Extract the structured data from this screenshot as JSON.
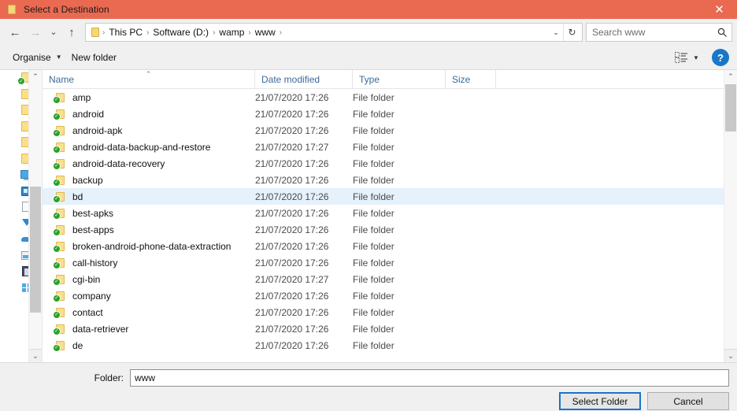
{
  "window": {
    "title": "Select a Destination",
    "icon": "folder-icon",
    "close_label": "✕",
    "titlebar_color": "#e96a51"
  },
  "nav": {
    "back": "←",
    "forward": "→",
    "recent": "⌄",
    "up": "↑",
    "dropdown": "⌄",
    "refresh": "↻"
  },
  "address": {
    "separator": "›",
    "crumbs": [
      "This PC",
      "Software (D:)",
      "wamp",
      "www"
    ]
  },
  "search": {
    "placeholder": "Search www",
    "value": "",
    "icon": "search-icon"
  },
  "commandbar": {
    "organise_label": "Organise",
    "organise_caret": "▼",
    "new_folder_label": "New folder",
    "view_caret": "▼",
    "help_label": "?"
  },
  "columns": {
    "name": "Name",
    "date_modified": "Date modified",
    "type": "Type",
    "size": "Size",
    "sort_caret": "⌃"
  },
  "files": [
    {
      "name": "amp",
      "date": "21/07/2020 17:26",
      "type": "File folder",
      "size": "",
      "selected": false
    },
    {
      "name": "android",
      "date": "21/07/2020 17:26",
      "type": "File folder",
      "size": "",
      "selected": false
    },
    {
      "name": "android-apk",
      "date": "21/07/2020 17:26",
      "type": "File folder",
      "size": "",
      "selected": false
    },
    {
      "name": "android-data-backup-and-restore",
      "date": "21/07/2020 17:27",
      "type": "File folder",
      "size": "",
      "selected": false
    },
    {
      "name": "android-data-recovery",
      "date": "21/07/2020 17:26",
      "type": "File folder",
      "size": "",
      "selected": false
    },
    {
      "name": "backup",
      "date": "21/07/2020 17:26",
      "type": "File folder",
      "size": "",
      "selected": false
    },
    {
      "name": "bd",
      "date": "21/07/2020 17:26",
      "type": "File folder",
      "size": "",
      "selected": true
    },
    {
      "name": "best-apks",
      "date": "21/07/2020 17:26",
      "type": "File folder",
      "size": "",
      "selected": false
    },
    {
      "name": "best-apps",
      "date": "21/07/2020 17:26",
      "type": "File folder",
      "size": "",
      "selected": false
    },
    {
      "name": "broken-android-phone-data-extraction",
      "date": "21/07/2020 17:26",
      "type": "File folder",
      "size": "",
      "selected": false
    },
    {
      "name": "call-history",
      "date": "21/07/2020 17:26",
      "type": "File folder",
      "size": "",
      "selected": false
    },
    {
      "name": "cgi-bin",
      "date": "21/07/2020 17:27",
      "type": "File folder",
      "size": "",
      "selected": false
    },
    {
      "name": "company",
      "date": "21/07/2020 17:26",
      "type": "File folder",
      "size": "",
      "selected": false
    },
    {
      "name": "contact",
      "date": "21/07/2020 17:26",
      "type": "File folder",
      "size": "",
      "selected": false
    },
    {
      "name": "data-retriever",
      "date": "21/07/2020 17:26",
      "type": "File folder",
      "size": "",
      "selected": false
    },
    {
      "name": "de",
      "date": "21/07/2020 17:26",
      "type": "File folder",
      "size": "",
      "selected": false
    }
  ],
  "sidebar": {
    "items": [
      {
        "icon": "folder-sync-icon"
      },
      {
        "icon": "folder-icon"
      },
      {
        "icon": "folder-icon"
      },
      {
        "icon": "folder-icon"
      },
      {
        "icon": "folder-icon"
      },
      {
        "icon": "folder-icon"
      },
      {
        "icon": "this-pc-icon"
      },
      {
        "icon": "local-disk-icon"
      },
      {
        "icon": "documents-icon"
      },
      {
        "icon": "downloads-icon"
      },
      {
        "icon": "onedrive-icon"
      },
      {
        "icon": "pictures-icon"
      },
      {
        "icon": "videos-icon"
      },
      {
        "icon": "apps-icon"
      }
    ],
    "scroll_up": "⌃",
    "scroll_down": "⌄"
  },
  "list_scroll": {
    "scroll_up": "⌃",
    "scroll_down": "⌄"
  },
  "footer": {
    "folder_label": "Folder:",
    "folder_value": "www",
    "select_button": "Select Folder",
    "cancel_button": "Cancel"
  },
  "colors": {
    "titlebar": "#e96a51",
    "selection": "#e5f1fb",
    "accent": "#1a73c8",
    "column_header_text": "#3c6a9a"
  }
}
